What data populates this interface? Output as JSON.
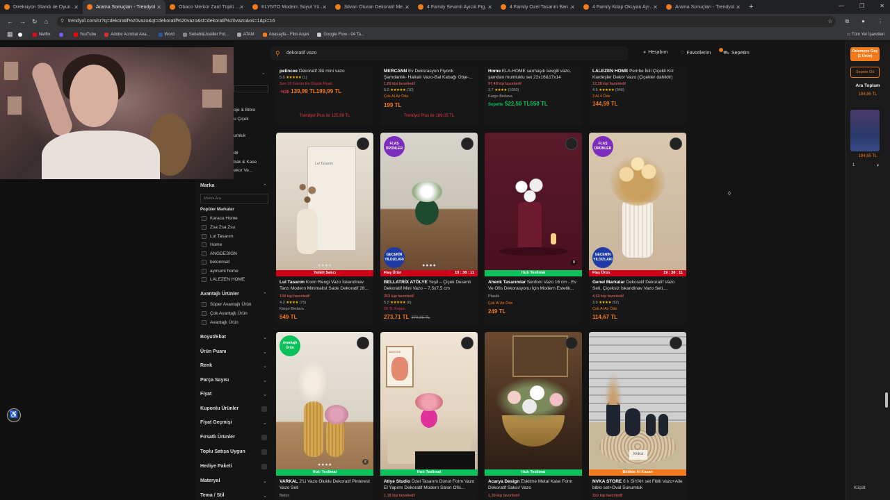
{
  "browser": {
    "tabs": [
      {
        "title": "Direksiyon Standı ile Oyun Y..."
      },
      {
        "title": "Arama Sonuçları - Trendyol",
        "active": true
      },
      {
        "title": "Obaco Merkür Zarif Tüplü Vazo..."
      },
      {
        "title": "KLYNTO Modern Soyut Yüz Her..."
      },
      {
        "title": "3dvan Oturan Dekoratif Melek..."
      },
      {
        "title": "4 Family Sevimli Ayıcık Figürü..."
      },
      {
        "title": "4 Family Özel Tasarım Barista A..."
      },
      {
        "title": "4 Family Kitap Okuyan Ayıcık B..."
      },
      {
        "title": "Arama Sonuçları - Trendyol"
      }
    ],
    "new_tab": "+",
    "url": "trendyol.com/sr?q=dekoratif%20vazo&qt=dekoratif%20vazo&st=dekoratif%20vazo&os=1&pi=16",
    "bookmarks": [
      {
        "label": "Netflix",
        "color": "#e50914"
      },
      {
        "label": "YouTube",
        "color": "#ff0000"
      },
      {
        "label": "Adobe Acrobat Ana...",
        "color": "#d32f2f"
      },
      {
        "label": "Word",
        "color": "#2b579a"
      },
      {
        "label": "Sebahi&Joailler Fot...",
        "color": "#888888"
      },
      {
        "label": "ATAM",
        "color": "#aaaaaa"
      },
      {
        "label": "Anasayfa - Film Arşivi",
        "color": "#f27a1a"
      },
      {
        "label": "Google Flow - 04 Ta...",
        "color": "#cccccc"
      }
    ],
    "all_bookmarks": "Tüm Yer İşaretleri"
  },
  "header": {
    "search_value": "dekoratif vazo",
    "account": "Hesabım",
    "favorites": "Favorilerim",
    "cart": "Sepetim"
  },
  "filters": {
    "partial_top": [
      "oje & Biblo",
      "u Çiçek",
      "umluk",
      "dil",
      "bak & Kase",
      "ekor Ve..."
    ],
    "brand_title": "Marka",
    "brand_search_placeholder": "Marka Ara",
    "popular_brands_title": "Popüler Markalar",
    "brands": [
      "Karaca Home",
      "Zsa Zsa Zsu",
      "Lul Tasarım",
      "Home",
      "ANGDESİGN",
      "betonmall",
      "aymumi home",
      "LALEZEN HOME"
    ],
    "advantage_title": "Avantajlı Ürünler",
    "advantage_items": [
      "Süper Avantajlı Ürün",
      "Çok Avantajlı Ürün",
      "Avantajlı Ürün"
    ],
    "sections": [
      "Boyut/Ebat",
      "Ürün Puanı",
      "Renk",
      "Parça Sayısı",
      "Fiyat",
      "Kuponlu Ürünler",
      "Fiyat Geçmişi",
      "Fırsatlı Ürünler",
      "Toplu Satışa Uygun",
      "Hediye Paketi",
      "Materyal",
      "Tema / Stil"
    ]
  },
  "top_row": [
    {
      "brand": "pelincee",
      "name": "Dekoratif 3lü mini vazo",
      "rating": "5.0",
      "reviews": "(1)",
      "note": "Son 10 Günün En Düşük Fiyatı",
      "discount": "-%30",
      "price": "139,99 TL",
      "old": "199,99 TL",
      "plus": "Trendyol Plus ile 125,99 TL"
    },
    {
      "brand": "MERCANN",
      "name": "Ev Dekorasyon Fiyonk Şamdanlık- Halkalı Vazo-Bal Kabağı Obje-...",
      "favs": "1,69 kişi favoriledi!",
      "rating": "5.0",
      "reviews": "(10)",
      "note": "Çok Al Az Öde",
      "price": "199 TL",
      "plus": "Trendyol Plus ile 189,05 TL"
    },
    {
      "brand": "Home",
      "name": "ELA-HOME sarmaşık sevgili vazo, şamdan mumluklu set 22x16&17x14",
      "favs": "97,48 kişi favoriledi!",
      "rating": "3.7",
      "reviews": "(1050)",
      "note": "Kargo Bedava",
      "cart_lbl": "Sepette",
      "price": "522,50 TL",
      "old": "550 TL"
    },
    {
      "brand": "LALEZEN HOME",
      "name": "Pembe İkili Çiçekli Kız Kardeşler Dekor Vazo (Çiçekler dahildir)",
      "favs": "12,38 kişi favoriledi!",
      "rating": "4.5",
      "reviews": "(546)",
      "note": "3 Al 4 Öde",
      "price": "144,59 TL"
    }
  ],
  "products": [
    {
      "brand": "Lul Tasarım",
      "name": "Krem Rengi Vazo İskandinav Tarzı Modern Minimalist Sade Dekoratif 28...",
      "strip": "Yetkili Satıcı",
      "favs": "108 kişi favoriledi!",
      "rating": "4.2",
      "reviews": "(75)",
      "note": "Kargo Bedava",
      "price": "549 TL",
      "img_text": "Lul Tasarım"
    },
    {
      "brand": "BELLATRİX ATÖLYE",
      "name": "Yeşil – Çiçek Desenli Dekoratif Mini Vazo – 7,5x7,5 cm",
      "strip": "Flaş Ürün",
      "timer": "19 : 38 : 11",
      "favs": "353 kişi favoriledi!",
      "rating": "5.0",
      "reviews": "(6)",
      "note": "20 TL Kupon",
      "price": "273,71 TL",
      "old": "370,35 TL",
      "badge": "FLAŞ ÜRÜNLER",
      "badge2": "GECENİN YILDIZLARI"
    },
    {
      "brand": "Ahenk Tasarımlar",
      "name": "Senfoni Vazo 16 cm - Ev Ve Ofis Dekorasyonu İçin Modern Estetik...",
      "strip": "Hızlı Teslimat",
      "material": "Plastik",
      "note": "Çok Al Az Öde",
      "price": "249 TL",
      "img_count": "8"
    },
    {
      "brand": "Genel Markalar",
      "name": "Dekoratif Dekoratif Vazo Seti, Çiçeksiz İskandinav Vazo Seti,...",
      "strip": "Flaş Ürün",
      "timer": "19 : 38 : 11",
      "favs": "4,69 kişi favoriledi!",
      "rating": "3.9",
      "reviews": "(92)",
      "note": "Çok Al Az Öde",
      "price": "114,67 TL",
      "badge": "FLAŞ ÜRÜNLER",
      "badge2": "GECENİN YILDIZLARI"
    },
    {
      "brand": "VARKAL",
      "name": "2'Li Vazo Oluklu Dekoratif Pinterest Vazo Seti",
      "strip": "Hızlı Teslimat",
      "material": "Beton",
      "img_count": "2",
      "badge": "Avantajlı Ürün"
    },
    {
      "brand": "Atiye Studio",
      "name": "Özel Tasarım Donut Form Vazo El Yapımı Dekoratif Modern Salon Ofis...",
      "strip": "Hızlı Teslimat",
      "favs": "1,18 kişi favoriledi!",
      "img_text": "MATISSE"
    },
    {
      "brand": "Acarya Design",
      "name": "Eskitme Metal Kase Form Dekoratif Saksı/ Vazo",
      "strip": "Hızlı Teslimat",
      "favs": "1,39 kişi favoriledi!"
    },
    {
      "brand": "NVKA STORE",
      "name": "6 lı SİYAH set Fitilli Vazo+Aile biblo set+Oval Sunumluk",
      "strip": "Birlikte Al Kazan",
      "favs": "322 kişi favoriledi!",
      "img_text": "NVKA"
    }
  ],
  "cart_panel": {
    "checkout": "Ödemeye Geç (1 Ürün)",
    "goto_cart": "Sepete Git",
    "subtotal_label": "Ara Toplam",
    "subtotal": "184,85 TL",
    "item_price": "184,85 TL",
    "qty": "1",
    "shrink": "Küçült"
  },
  "colors": {
    "brand": "#f27a1a",
    "flash": "#d0021b",
    "fast": "#0bc15c",
    "together": "#f27a1a"
  }
}
